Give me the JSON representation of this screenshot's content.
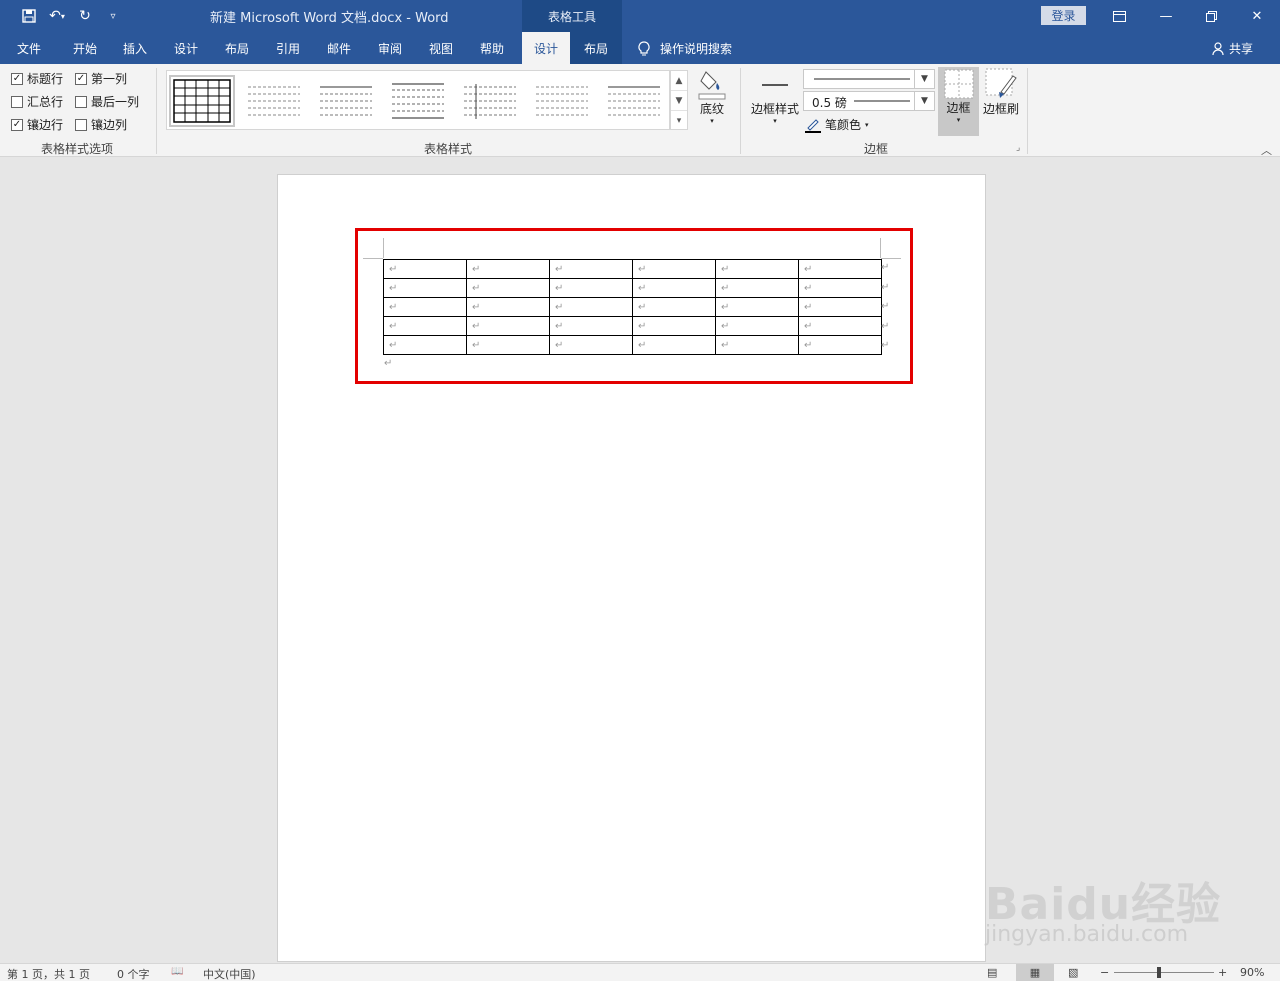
{
  "titlebar": {
    "doc_title": "新建 Microsoft Word 文档.docx  -  Word",
    "context_label": "表格工具",
    "login": "登录"
  },
  "tabs": {
    "file": "文件",
    "home": "开始",
    "insert": "插入",
    "design": "设计",
    "layout": "布局",
    "references": "引用",
    "mailings": "邮件",
    "review": "审阅",
    "view": "视图",
    "help": "帮助",
    "table_design": "设计",
    "table_layout": "布局",
    "tell_me": "操作说明搜索",
    "share": "共享"
  },
  "ribbon": {
    "style_options": {
      "header_row": "标题行",
      "first_column": "第一列",
      "total_row": "汇总行",
      "last_column": "最后一列",
      "banded_rows": "镶边行",
      "banded_columns": "镶边列",
      "group_label": "表格样式选项",
      "header_row_checked": true,
      "first_column_checked": true,
      "total_row_checked": false,
      "last_column_checked": false,
      "banded_rows_checked": true,
      "banded_columns_checked": false
    },
    "table_styles": {
      "group_label": "表格样式",
      "shading": "底纹"
    },
    "borders": {
      "border_styles": "边框样式",
      "pen_weight": "0.5 磅",
      "pen_color": "笔颜色",
      "borders_btn": "边框",
      "border_painter": "边框刷",
      "group_label": "边框"
    }
  },
  "document": {
    "cell_mark": "↵",
    "rows": 5,
    "columns": 6
  },
  "watermark": {
    "line1": "Baidu经验",
    "line2": "jingyan.baidu.com"
  },
  "statusbar": {
    "page": "第 1 页，共 1 页",
    "words": "0 个字",
    "language": "中文(中国)",
    "zoom": "90%"
  },
  "colors": {
    "accent": "#2b579a",
    "highlight": "#e30000"
  }
}
